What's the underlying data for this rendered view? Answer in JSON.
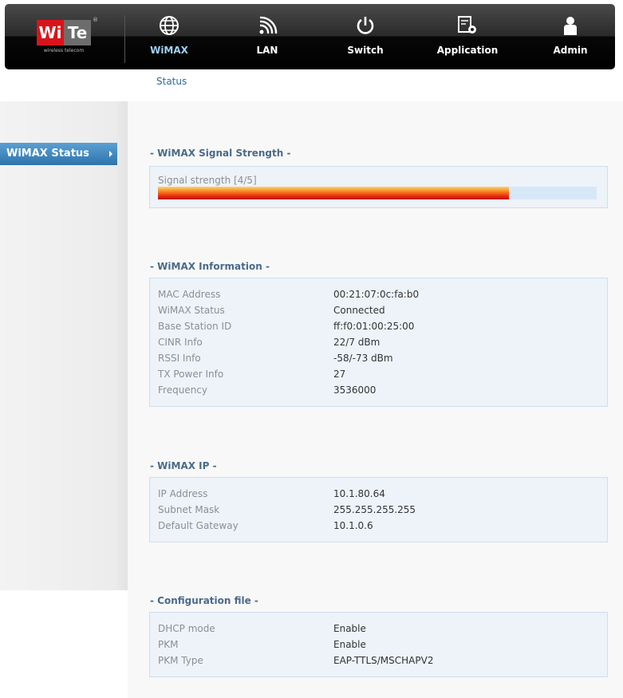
{
  "brand": {
    "logo_left": "Wi",
    "logo_right": "Te",
    "tagline": "wireless telecom",
    "reg_mark": "®"
  },
  "nav": {
    "items": [
      {
        "label": "WiMAX",
        "icon": "globe-icon",
        "active": true
      },
      {
        "label": "LAN",
        "icon": "wireless-signal-icon",
        "active": false
      },
      {
        "label": "Switch",
        "icon": "power-icon",
        "active": false
      },
      {
        "label": "Application",
        "icon": "application-gear-icon",
        "active": false
      },
      {
        "label": "Admin",
        "icon": "user-icon",
        "active": false
      }
    ],
    "active_color": "#9fd2f4"
  },
  "subnav": {
    "status_label": "Status"
  },
  "sidebar": {
    "items": [
      {
        "label": "WiMAX Status",
        "selected": true
      }
    ]
  },
  "signal": {
    "title": "- WiMAX Signal Strength -",
    "label": "Signal strength [4/5]",
    "level_fraction": 0.8
  },
  "info": {
    "title": "- WiMAX Information -",
    "rows": [
      {
        "key": "MAC Address",
        "value": "00:21:07:0c:fa:b0"
      },
      {
        "key": "WiMAX Status",
        "value": "Connected"
      },
      {
        "key": "Base Station ID",
        "value": "ff:f0:01:00:25:00"
      },
      {
        "key": "CINR Info",
        "value": "22/7 dBm"
      },
      {
        "key": "RSSI Info",
        "value": "-58/-73 dBm"
      },
      {
        "key": "TX Power Info",
        "value": "27"
      },
      {
        "key": "Frequency",
        "value": "3536000"
      }
    ]
  },
  "ip": {
    "title": "- WiMAX IP -",
    "rows": [
      {
        "key": "IP Address",
        "value": "10.1.80.64"
      },
      {
        "key": "Subnet Mask",
        "value": "255.255.255.255"
      },
      {
        "key": "Default Gateway",
        "value": "10.1.0.6"
      }
    ]
  },
  "config": {
    "title": "- Configuration file -",
    "rows": [
      {
        "key": "DHCP mode",
        "value": "Enable"
      },
      {
        "key": "PKM",
        "value": "Enable"
      },
      {
        "key": "PKM Type",
        "value": "EAP-TTLS/MSCHAPV2"
      }
    ]
  }
}
